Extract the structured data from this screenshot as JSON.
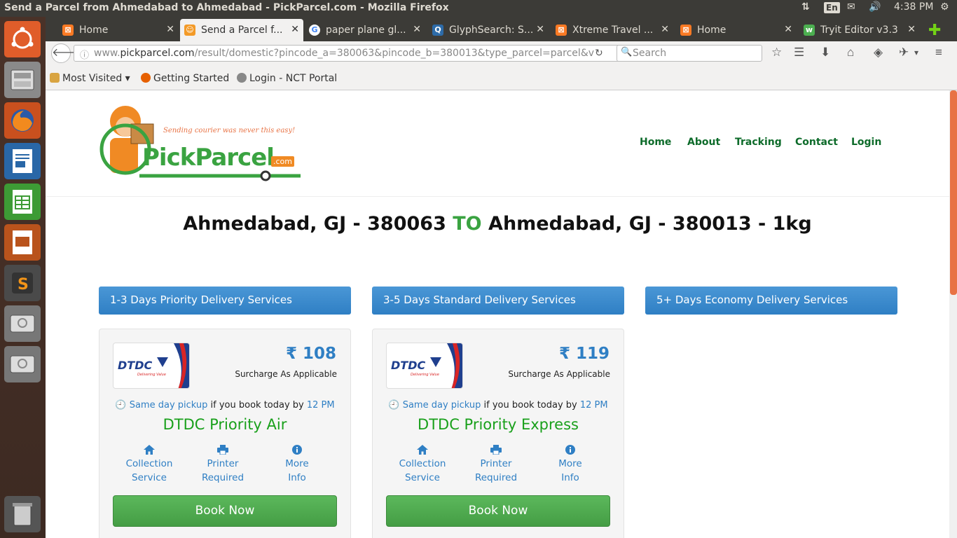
{
  "os": {
    "window_title": "Send a Parcel from Ahmedabad to Ahmedabad - PickParcel.com - Mozilla Firefox",
    "keyboard_layout": "En",
    "clock": "4:38 PM"
  },
  "launcher": {
    "items": [
      "dash-home-icon",
      "files-icon",
      "firefox-icon",
      "writer-icon",
      "calc-icon",
      "impress-icon",
      "sublime-icon",
      "drive-icon",
      "drive-icon",
      "trash-icon"
    ]
  },
  "tabs": [
    {
      "label": "Home",
      "favicon": "xampp-icon",
      "active": false
    },
    {
      "label": "Send a Parcel f...",
      "favicon": "pickparcel-icon",
      "active": true
    },
    {
      "label": "paper plane gl...",
      "favicon": "google-icon",
      "active": false
    },
    {
      "label": "GlyphSearch: S...",
      "favicon": "glyphsearch-icon",
      "active": false
    },
    {
      "label": "Xtreme Travel ...",
      "favicon": "xampp-icon",
      "active": false
    },
    {
      "label": "Home",
      "favicon": "xampp-icon",
      "active": false
    },
    {
      "label": "Tryit Editor v3.3",
      "favicon": "w3-icon",
      "active": false
    }
  ],
  "urlbar": {
    "prefix": "www.",
    "domain": "pickparcel.com",
    "path": "/result/domestic?pincode_a=380063&pincode_b=380013&type_parcel=parcel&v",
    "search_placeholder": "Search"
  },
  "bookmarks": [
    {
      "label": "Most Visited",
      "icon": "folder-icon"
    },
    {
      "label": "Getting Started",
      "icon": "firefox-icon"
    },
    {
      "label": "Login - NCT Portal",
      "icon": "globe-icon"
    }
  ],
  "site": {
    "tagline": "Sending courier was never this easy!",
    "brand": "PickParcel",
    "brand_suffix": ".com",
    "menu": [
      "Home",
      "About",
      "Tracking",
      "Contact",
      "Login"
    ]
  },
  "route": {
    "from": "Ahmedabad, GJ - 380063",
    "sep": "TO",
    "to": "Ahmedabad, GJ - 380013 - 1kg"
  },
  "categories": [
    "1-3 Days Priority Delivery Services",
    "3-5 Days Standard Delivery Services",
    "5+ Days Economy Delivery Services"
  ],
  "cards": [
    {
      "logo_text": "DTDC",
      "logo_sub": "Delivering Value",
      "price": "₹ 108",
      "surcharge": "Surcharge As Applicable",
      "pickup_pre": "Same day pickup",
      "pickup_mid": " if you book today by ",
      "pickup_time": "12 PM",
      "service": "DTDC Priority Air",
      "features": [
        {
          "line1": "Collection",
          "line2": "Service",
          "icon": "home-icon"
        },
        {
          "line1": "Printer",
          "line2": "Required",
          "icon": "printer-icon"
        },
        {
          "line1": "More",
          "line2": "Info",
          "icon": "info-icon"
        }
      ],
      "cta": "Book Now"
    },
    {
      "logo_text": "DTDC",
      "logo_sub": "Delivering Value",
      "price": "₹ 119",
      "surcharge": "Surcharge As Applicable",
      "pickup_pre": "Same day pickup",
      "pickup_mid": " if you book today by ",
      "pickup_time": "12 PM",
      "service": "DTDC Priority Express",
      "features": [
        {
          "line1": "Collection",
          "line2": "Service",
          "icon": "home-icon"
        },
        {
          "line1": "Printer",
          "line2": "Required",
          "icon": "printer-icon"
        },
        {
          "line1": "More",
          "line2": "Info",
          "icon": "info-icon"
        }
      ],
      "cta": "Book Now"
    }
  ],
  "colors": {
    "brand_green": "#3aa341",
    "menu_green": "#0d6b2a",
    "blue": "#2f7fc4",
    "orange": "#e87345",
    "service_green": "#19a01b"
  }
}
